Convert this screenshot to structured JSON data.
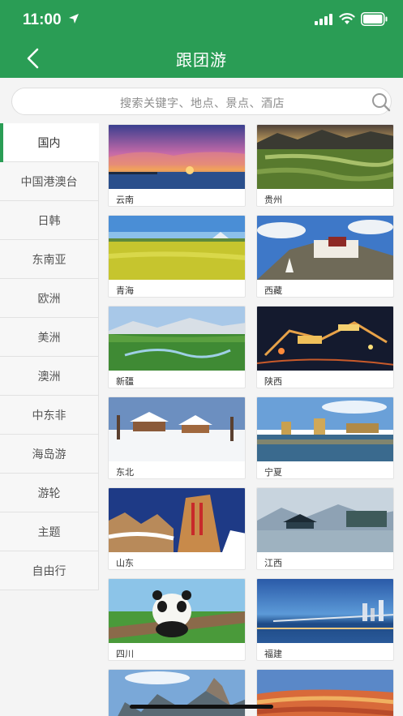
{
  "status": {
    "time": "11:00"
  },
  "header": {
    "title": "跟团游"
  },
  "search": {
    "placeholder": "搜索关键字、地点、景点、酒店"
  },
  "sidebar": {
    "items": [
      {
        "label": "国内",
        "active": true
      },
      {
        "label": "中国港澳台"
      },
      {
        "label": "日韩"
      },
      {
        "label": "东南亚"
      },
      {
        "label": "欧洲"
      },
      {
        "label": "美洲"
      },
      {
        "label": "澳洲"
      },
      {
        "label": "中东非"
      },
      {
        "label": "海岛游"
      },
      {
        "label": "游轮"
      },
      {
        "label": "主题"
      },
      {
        "label": "自由行"
      }
    ]
  },
  "destinations": [
    {
      "label": "云南"
    },
    {
      "label": "贵州"
    },
    {
      "label": "青海"
    },
    {
      "label": "西藏"
    },
    {
      "label": "新疆"
    },
    {
      "label": "陕西"
    },
    {
      "label": "东北"
    },
    {
      "label": "宁夏"
    },
    {
      "label": "山东"
    },
    {
      "label": "江西"
    },
    {
      "label": "四川"
    },
    {
      "label": "福建"
    },
    {
      "label": ""
    },
    {
      "label": ""
    }
  ],
  "colors": {
    "brand": "#2a9d55"
  }
}
